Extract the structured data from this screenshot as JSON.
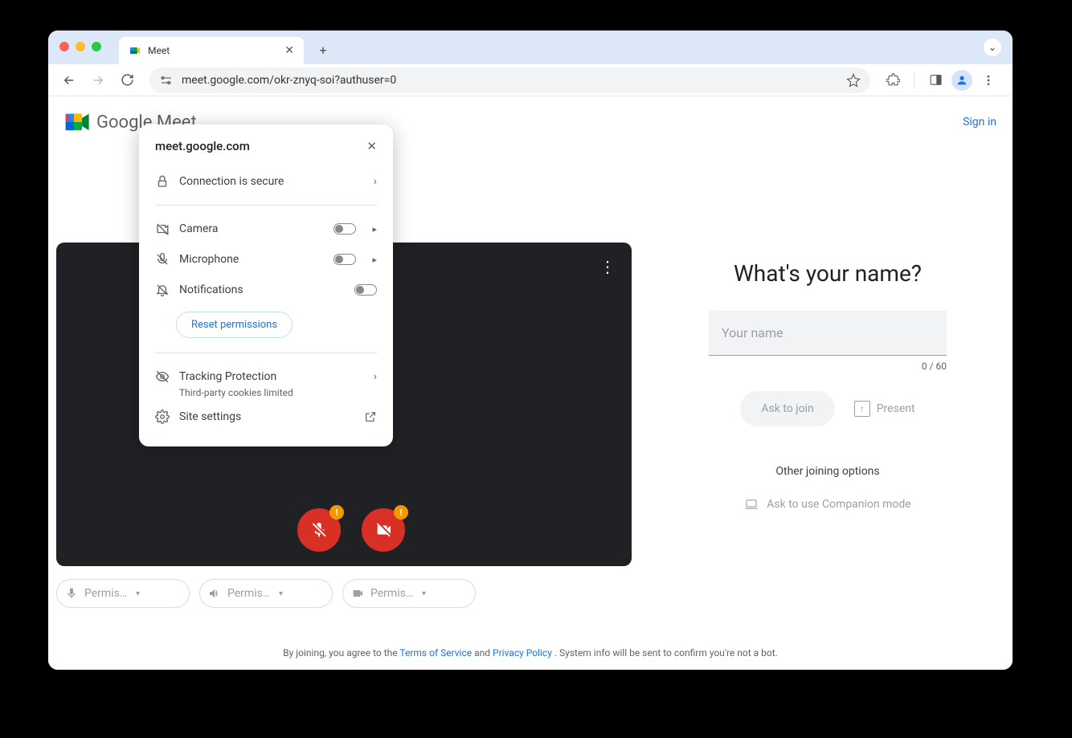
{
  "browser_tab": {
    "title": "Meet"
  },
  "omnibox": {
    "url": "meet.google.com/okr-znyq-soi?authuser=0"
  },
  "header": {
    "logo_text": "Google Meet",
    "sign_in": "Sign in"
  },
  "site_popup": {
    "domain": "meet.google.com",
    "connection": "Connection is secure",
    "permissions": [
      {
        "icon": "camera-off",
        "label": "Camera",
        "chevron": true
      },
      {
        "icon": "microphone-off",
        "label": "Microphone",
        "chevron": true
      },
      {
        "icon": "notifications-off",
        "label": "Notifications",
        "chevron": false
      }
    ],
    "reset": "Reset permissions",
    "tracking": {
      "title": "Tracking Protection",
      "subtitle": "Third-party cookies limited"
    },
    "site_settings": "Site settings"
  },
  "preview": {
    "permission_chips": [
      "Permission needed",
      "Permission needed",
      "Permission needed"
    ]
  },
  "join_panel": {
    "title": "What's your name?",
    "name_placeholder": "Your name",
    "name_value": "",
    "counter": "0 / 60",
    "ask_to_join": "Ask to join",
    "present": "Present",
    "other_options": "Other joining options",
    "companion": "Ask to use Companion mode"
  },
  "footer": {
    "prefix": "By joining, you agree to the ",
    "tos": "Terms of Service",
    "and": " and ",
    "privacy": "Privacy Policy",
    "suffix": ". System info will be sent to confirm you're not a bot."
  }
}
